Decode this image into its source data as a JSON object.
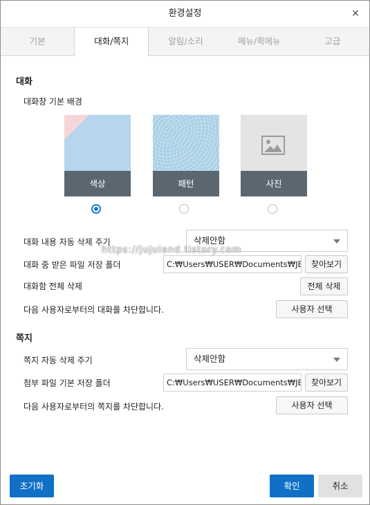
{
  "window": {
    "title": "환경설정"
  },
  "tabs": [
    "기본",
    "대화/쪽지",
    "알림/소리",
    "메뉴/퀵메뉴",
    "고급"
  ],
  "active_tab": 1,
  "chat": {
    "section_title": "대화",
    "bg_label": "대화창 기본 배경",
    "bg_options": [
      {
        "label": "색상",
        "selected": true
      },
      {
        "label": "패턴",
        "selected": false
      },
      {
        "label": "사진",
        "selected": false
      }
    ],
    "auto_delete_label": "대화 내용 자동 삭제 주기",
    "auto_delete_value": "삭제안함",
    "file_folder_label": "대화 중 받은 파일 저장 폴더",
    "file_folder_path": "C:₩Users₩USER₩Documents₩JBE",
    "browse_label": "찾아보기",
    "delete_all_label": "대화함 전체 삭제",
    "delete_all_button": "전체 삭제",
    "block_label": "다음 사용자로부터의 대화를 차단합니다.",
    "user_select_button": "사용자 선택"
  },
  "note": {
    "section_title": "쪽지",
    "auto_delete_label": "쪽지 자동 삭제 주기",
    "auto_delete_value": "삭제안함",
    "file_folder_label": "첨부 파일 기본 저장 폴더",
    "file_folder_path": "C:₩Users₩USER₩Documents₩JBE",
    "browse_label": "찾아보기",
    "block_label": "다음 사용자로부터의 쪽지를 차단합니다.",
    "user_select_button": "사용자 선택"
  },
  "footer": {
    "reset": "초기화",
    "ok": "확인",
    "cancel": "취소"
  },
  "watermark": "https://jujuland.tistory.com",
  "colors": {
    "accent": "#1070c6",
    "card_caption": "#5b6770",
    "card_color_bg": "#b6d6ee",
    "card_pattern_bg": "#a9cfe6",
    "card_photo_bg": "#e4e4e4"
  },
  "icons": {
    "close": "close-icon",
    "photo": "image-icon",
    "dropdown": "chevron-down-icon"
  }
}
